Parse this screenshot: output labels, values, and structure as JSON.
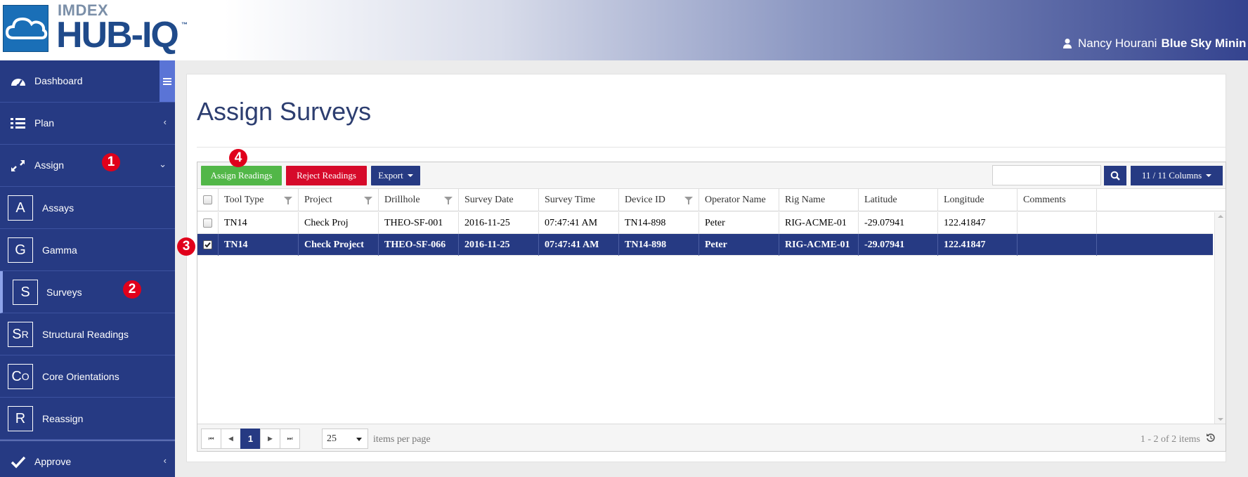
{
  "header": {
    "brand": "IMDEX",
    "product": "HUB-IQ",
    "tm": "™",
    "user_name": "Nancy Hourani",
    "organization": "Blue Sky Minin"
  },
  "sidebar": {
    "items": [
      {
        "label": "Dashboard",
        "icon": "dashboard-icon"
      },
      {
        "label": "Plan",
        "icon": "list-icon"
      },
      {
        "label": "Assign",
        "icon": "expand-arrows-icon"
      },
      {
        "label": "Assays",
        "letter": "A"
      },
      {
        "label": "Gamma",
        "letter": "G"
      },
      {
        "label": "Surveys",
        "letter": "S"
      },
      {
        "label": "Structural Readings",
        "letter": "SR"
      },
      {
        "label": "Core Orientations",
        "letter": "CO"
      },
      {
        "label": "Reassign",
        "letter": "R"
      },
      {
        "label": "Approve",
        "icon": "check-icon"
      }
    ]
  },
  "badges": {
    "b1": "1",
    "b2": "2",
    "b3": "3",
    "b4": "4"
  },
  "page": {
    "title": "Assign Surveys"
  },
  "toolbar": {
    "assign_label": "Assign Readings",
    "reject_label": "Reject Readings",
    "export_label": "Export",
    "columns_label": "11 / 11 Columns",
    "search_placeholder": ""
  },
  "table": {
    "columns": [
      "Tool Type",
      "Project",
      "Drillhole",
      "Survey Date",
      "Survey Time",
      "Device ID",
      "Operator Name",
      "Rig Name",
      "Latitude",
      "Longitude",
      "Comments"
    ],
    "rows": [
      {
        "selected": false,
        "cells": [
          "TN14",
          "Check Proj",
          "THEO-SF-001",
          "2016-11-25",
          "07:47:41 AM",
          "TN14-898",
          "Peter",
          "RIG-ACME-01",
          "-29.07941",
          "122.41847",
          ""
        ]
      },
      {
        "selected": true,
        "cells": [
          "TN14",
          "Check Project",
          "THEO-SF-066",
          "2016-11-25",
          "07:47:41 AM",
          "TN14-898",
          "Peter",
          "RIG-ACME-01",
          "-29.07941",
          "122.41847",
          ""
        ]
      }
    ]
  },
  "pager": {
    "current_page": "1",
    "per_page": "25",
    "per_page_label": "items per page",
    "info": "1 - 2 of 2 items"
  },
  "colors": {
    "navy": "#263a83",
    "green": "#52b748",
    "red": "#d60a2a",
    "badge_red": "#e0001b"
  }
}
